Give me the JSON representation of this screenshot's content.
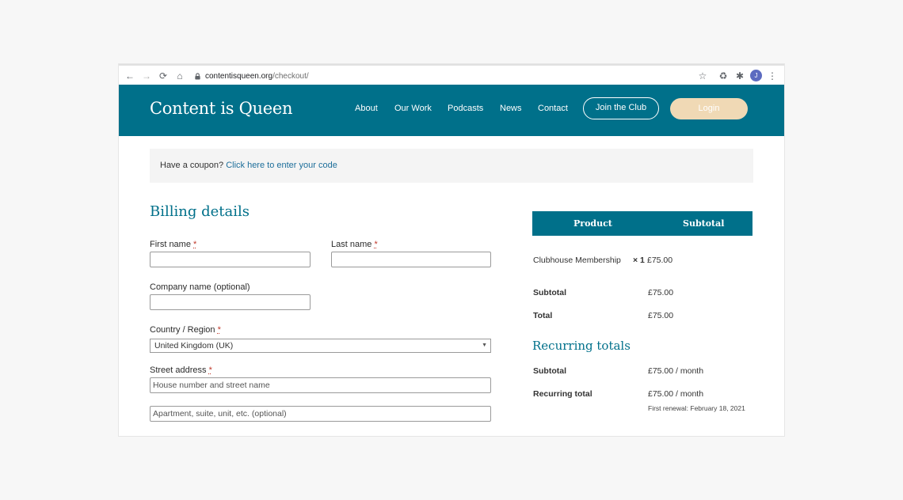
{
  "browser": {
    "url_domain": "contentisqueen.org",
    "url_path": "/checkout/",
    "avatar_letter": "J",
    "icons": [
      "back-icon",
      "forward-icon",
      "reload-icon",
      "home-icon",
      "lock-icon",
      "star-icon",
      "recycle-icon",
      "puzzle-icon",
      "menu-dots-icon"
    ]
  },
  "header": {
    "logo": "Content is Queen",
    "nav": [
      "About",
      "Our Work",
      "Podcasts",
      "News",
      "Contact"
    ],
    "join_label": "Join the Club",
    "login_label": "Login",
    "brand_color": "#00708a",
    "login_color": "#f0d9b5"
  },
  "coupon": {
    "text": "Have a coupon?",
    "link": "Click here to enter your code"
  },
  "billing": {
    "title": "Billing details",
    "first_name_label": "First name",
    "last_name_label": "Last name",
    "company_label": "Company name (optional)",
    "country_label": "Country / Region",
    "country_value": "United Kingdom (UK)",
    "street_label": "Street address",
    "street_placeholder": "House number and street name",
    "apartment_placeholder": "Apartment, suite, unit, etc. (optional)",
    "required_mark": "*"
  },
  "order": {
    "col_product": "Product",
    "col_subtotal": "Subtotal",
    "item_name": "Clubhouse Membership",
    "item_qty": "× 1",
    "item_price": "£75.00",
    "subtotal_label": "Subtotal",
    "subtotal_value": "£75.00",
    "total_label": "Total",
    "total_value": "£75.00"
  },
  "recurring": {
    "title": "Recurring totals",
    "subtotal_label": "Subtotal",
    "subtotal_value": "£75.00 / month",
    "total_label": "Recurring total",
    "total_value": "£75.00 / month",
    "first_renewal": "First renewal: February 18, 2021"
  }
}
